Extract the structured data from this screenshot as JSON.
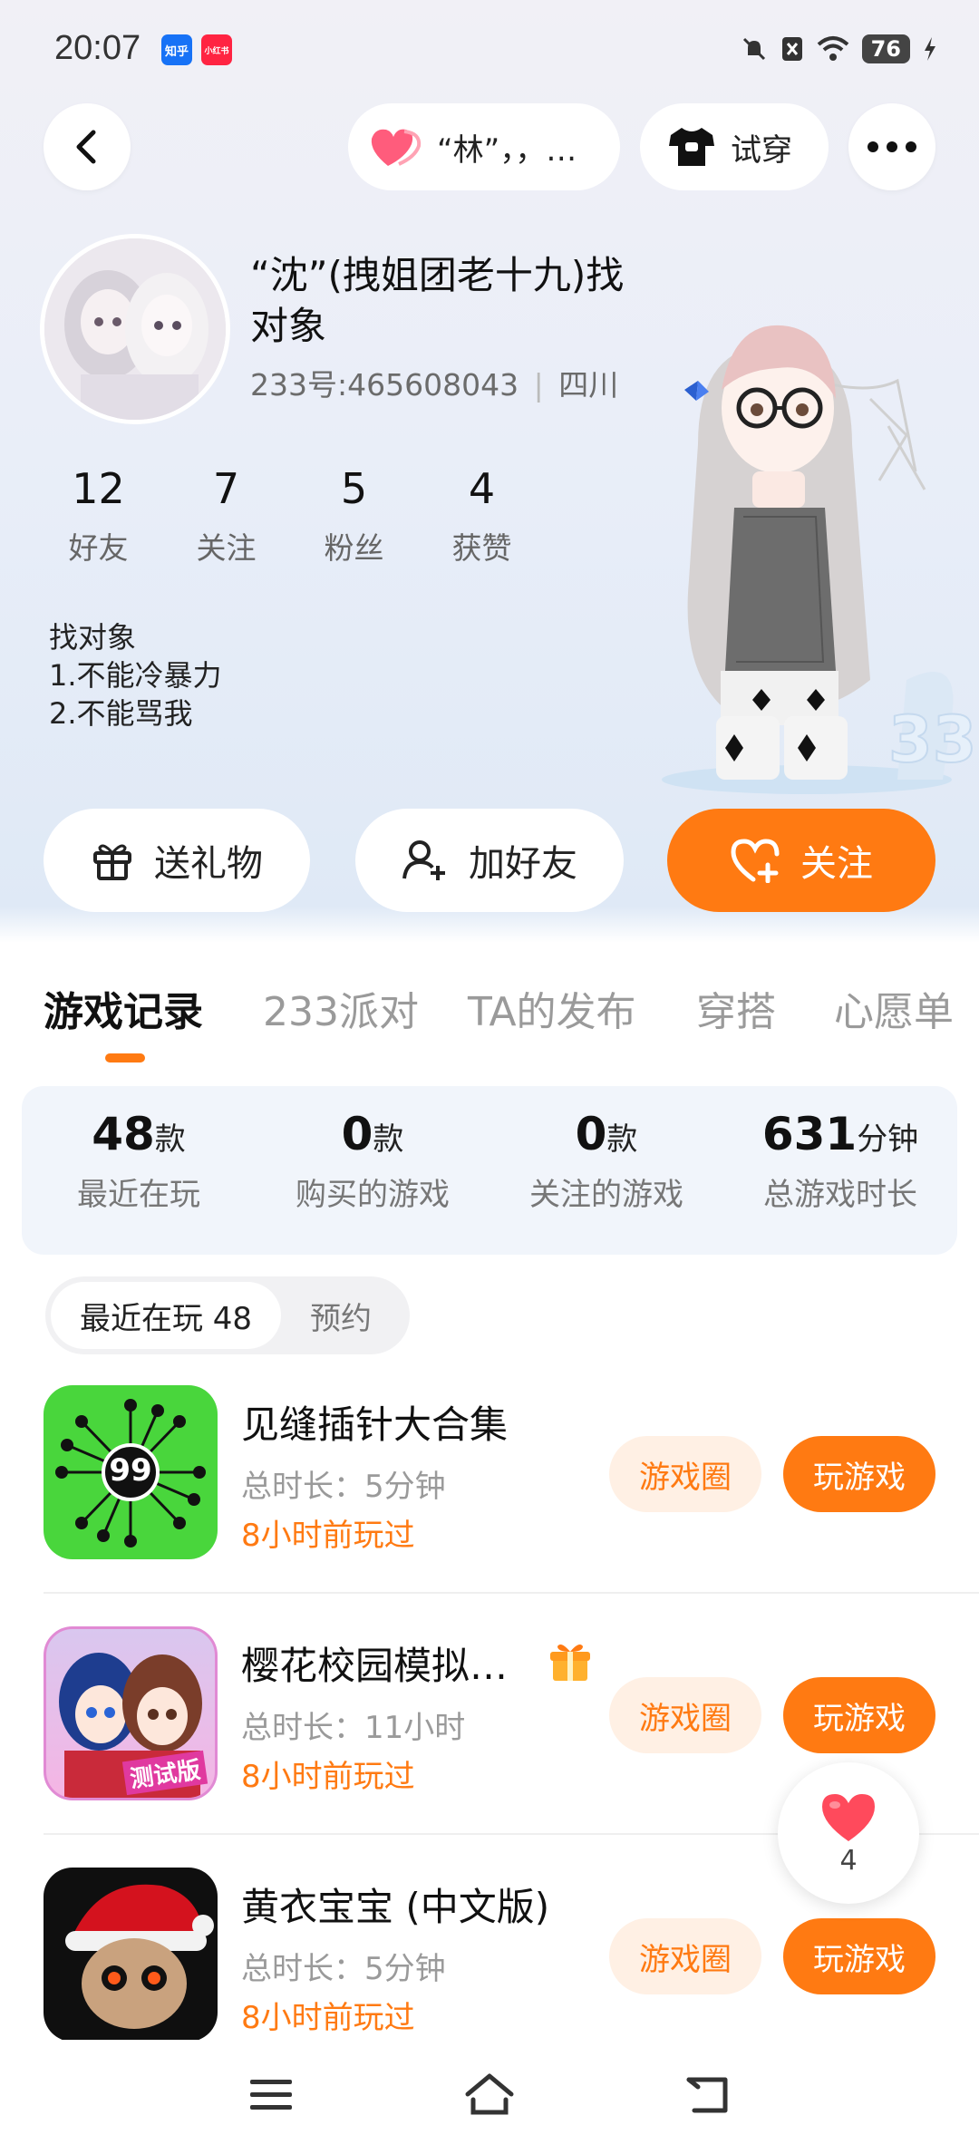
{
  "status_bar": {
    "time": "20:07",
    "battery": "76",
    "app_icon_1": "知乎",
    "app_icon_2": "小红书"
  },
  "top_bar": {
    "relation_text": "“林”，，…",
    "try_on_label": "试穿"
  },
  "profile": {
    "name": "“沈”(拽姐团老十九)找对象",
    "uid": "233号:465608043",
    "location": "四川",
    "stats": [
      {
        "value": "12",
        "label": "好友"
      },
      {
        "value": "7",
        "label": "关注"
      },
      {
        "value": "5",
        "label": "粉丝"
      },
      {
        "value": "4",
        "label": "获赞"
      }
    ],
    "bio": [
      "找对象",
      "1.不能冷暴力",
      "2.不能骂我"
    ]
  },
  "actions": {
    "gift": "送礼物",
    "add_friend": "加好友",
    "follow": "关注"
  },
  "tabs": [
    "游戏记录",
    "233派对",
    "TA的发布",
    "穿搭",
    "心愿单"
  ],
  "summary": [
    {
      "value": "48",
      "unit": "款",
      "label": "最近在玩"
    },
    {
      "value": "0",
      "unit": "款",
      "label": "购买的游戏"
    },
    {
      "value": "0",
      "unit": "款",
      "label": "关注的游戏"
    },
    {
      "value": "631",
      "unit": "分钟",
      "label": "总游戏时长"
    }
  ],
  "segment": {
    "active": "最近在玩 48",
    "inactive": "预约"
  },
  "games": [
    {
      "title": "见缝插针大合集",
      "duration": "总时长：5分钟",
      "last_played": "8小时前玩过",
      "circle_label": "游戏圈",
      "play_label": "玩游戏",
      "icon_text": "99"
    },
    {
      "title": "樱花校园模拟…",
      "duration": "总时长：11小时",
      "last_played": "8小时前玩过",
      "circle_label": "游戏圈",
      "play_label": "玩游戏",
      "icon_text": "测试版"
    },
    {
      "title": "黄衣宝宝 (中文版)",
      "duration": "总时长：5分钟",
      "last_played": "8小时前玩过",
      "circle_label": "游戏圈",
      "play_label": "玩游戏"
    }
  ],
  "like_float": {
    "count": "4"
  },
  "colors": {
    "accent": "#ff7a12",
    "accent_light": "#fff0e4",
    "summary_bg": "#f1f5fb"
  }
}
